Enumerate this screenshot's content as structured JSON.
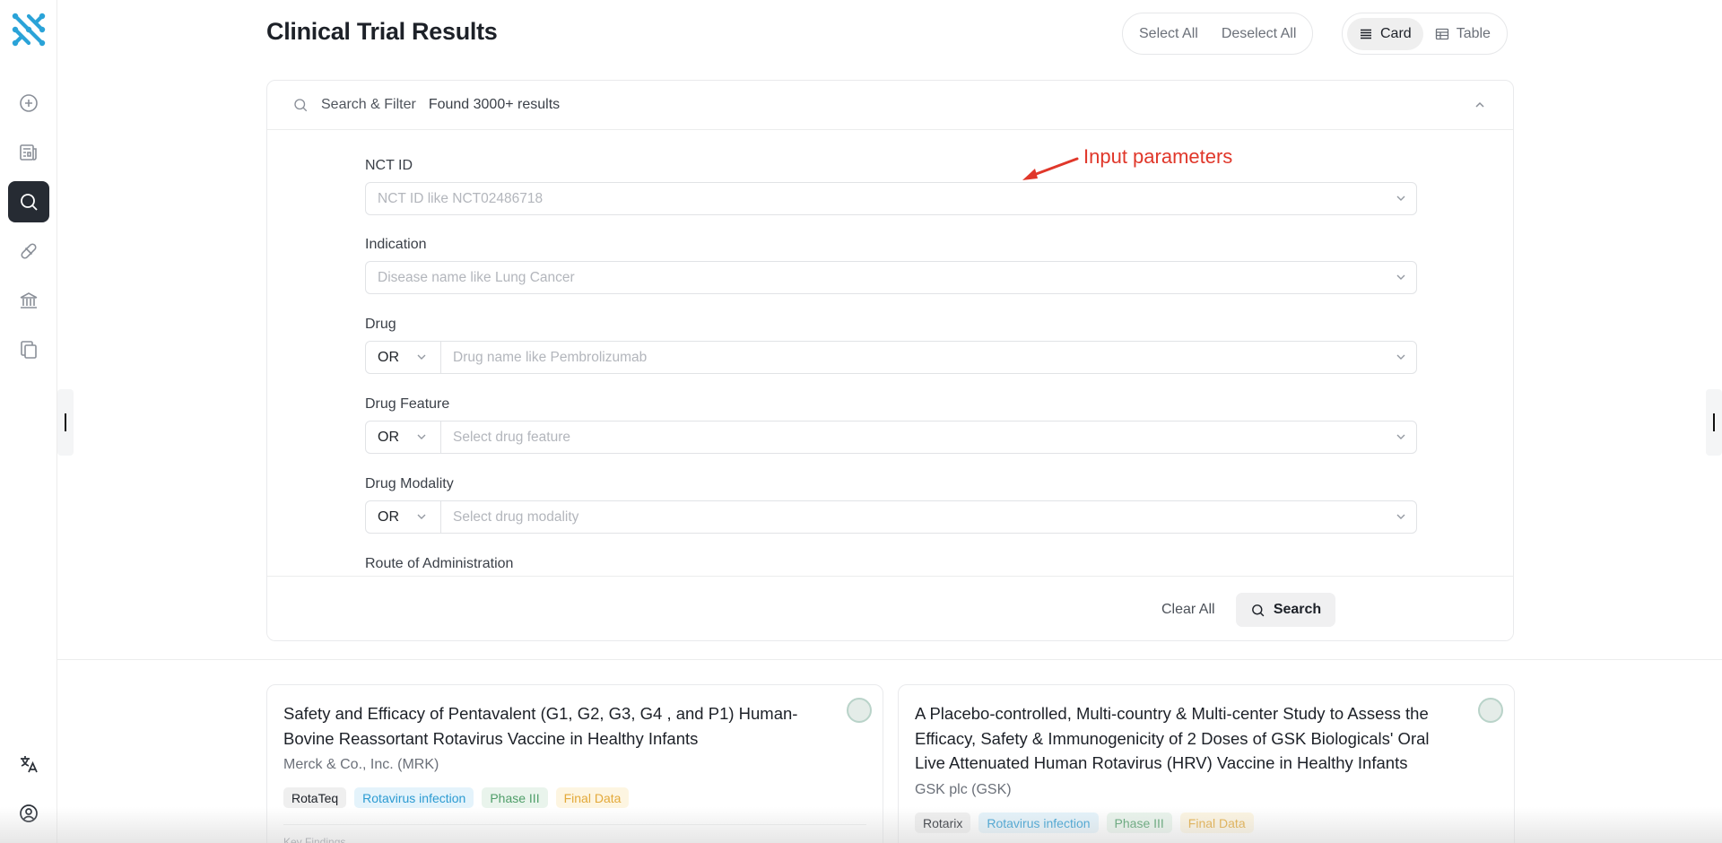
{
  "header": {
    "title": "Clinical Trial Results"
  },
  "selection": {
    "select_all": "Select All",
    "deselect_all": "Deselect All"
  },
  "view_toggle": {
    "card": "Card",
    "table": "Table",
    "active": "card"
  },
  "filter_panel": {
    "title": "Search & Filter",
    "found": "Found 3000+ results",
    "fields": [
      {
        "label": "NCT ID",
        "placeholder": "NCT ID like NCT02486718"
      },
      {
        "label": "Indication",
        "placeholder": "Disease name like Lung Cancer"
      },
      {
        "label": "Drug",
        "operator": "OR",
        "placeholder": "Drug name like Pembrolizumab"
      },
      {
        "label": "Drug Feature",
        "operator": "OR",
        "placeholder": "Select drug feature"
      },
      {
        "label": "Drug Modality",
        "operator": "OR",
        "placeholder": "Select drug modality"
      },
      {
        "label": "Route of Administration"
      }
    ],
    "clear_all": "Clear All",
    "search": "Search"
  },
  "annotation": {
    "text": "Input parameters",
    "color": "#e0372a"
  },
  "cards": [
    {
      "title": "Safety and Efficacy of Pentavalent (G1, G2, G3, G4 , and P1) Human-Bovine Reassortant Rotavirus Vaccine in Healthy Infants",
      "company": "Merck & Co., Inc. (MRK)",
      "tags": {
        "drug": "RotaTeq",
        "indication": "Rotavirus infection",
        "phase": "Phase III",
        "status": "Final Data"
      },
      "section": "Key Findings"
    },
    {
      "title": "A Placebo-controlled, Multi-country & Multi-center Study to Assess the Efficacy, Safety & Immunogenicity of 2 Doses of GSK Biologicals' Oral Live Attenuated Human Rotavirus (HRV) Vaccine in Healthy Infants",
      "company": "GSK plc (GSK)",
      "tags": {
        "drug": "Rotarix",
        "indication": "Rotavirus infection",
        "phase": "Phase III",
        "status": "Final Data"
      }
    }
  ],
  "sidebar": {
    "items": [
      {
        "icon": "plus-circle-icon"
      },
      {
        "icon": "newspaper-icon"
      },
      {
        "icon": "search-icon",
        "active": true
      },
      {
        "icon": "pill-icon"
      },
      {
        "icon": "bank-icon"
      },
      {
        "icon": "copy-icon"
      }
    ],
    "bottom": [
      {
        "icon": "translate-icon"
      },
      {
        "icon": "user-circle-icon"
      }
    ]
  },
  "colors": {
    "accent_dark": "#262b33",
    "indication_tag": "#2c9bd2",
    "phase_tag": "#4f9e69",
    "status_tag": "#e3a93a"
  }
}
